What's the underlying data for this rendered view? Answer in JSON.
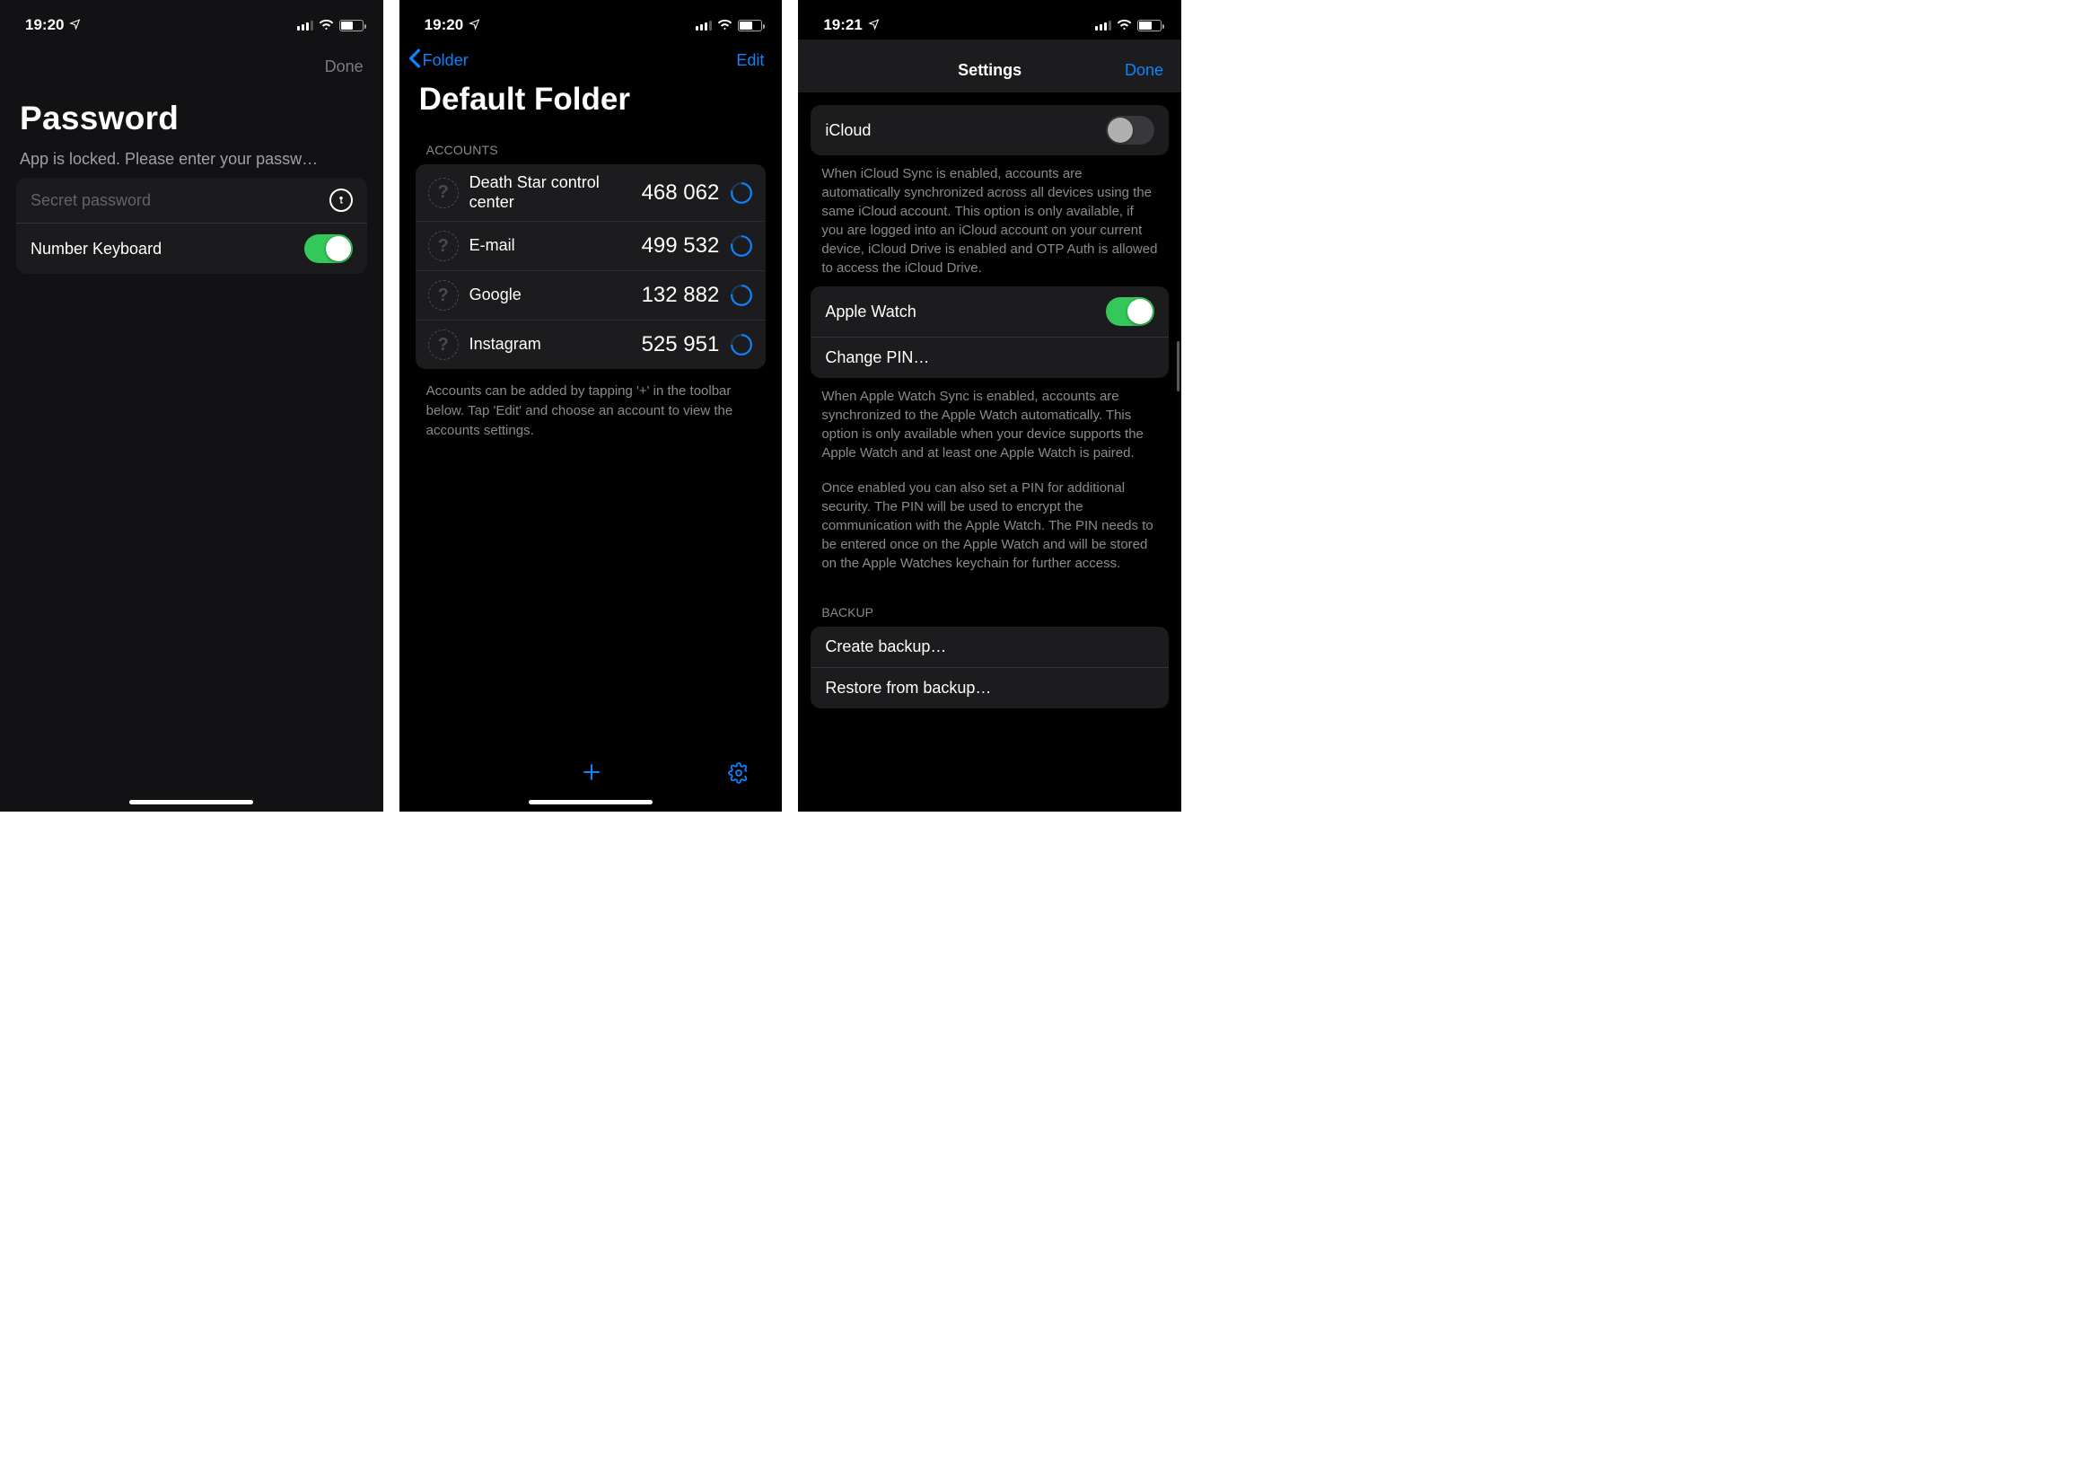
{
  "screen1": {
    "status_time": "19:20",
    "done_label": "Done",
    "title": "Password",
    "subtitle": "App is locked. Please enter your passw…",
    "password_placeholder": "Secret password",
    "number_keyboard_label": "Number Keyboard"
  },
  "screen2": {
    "status_time": "19:20",
    "back_label": "Folder",
    "edit_label": "Edit",
    "title": "Default Folder",
    "accounts_header": "ACCOUNTS",
    "accounts": [
      {
        "name": "Death Star control center",
        "code": "468 062"
      },
      {
        "name": "E-mail",
        "code": "499 532"
      },
      {
        "name": "Google",
        "code": "132 882"
      },
      {
        "name": "Instagram",
        "code": "525 951"
      }
    ],
    "footer": "Accounts can be added by tapping '+' in the toolbar below. Tap 'Edit' and choose an account to view the accounts settings."
  },
  "screen3": {
    "status_time": "19:21",
    "title": "Settings",
    "done_label": "Done",
    "icloud_label": "iCloud",
    "icloud_help": "When iCloud Sync is enabled, accounts are automatically synchronized across all devices using the same iCloud account. This option is only available, if you are logged into an iCloud account on your current device, iCloud Drive is enabled and OTP Auth is allowed to access the iCloud Drive.",
    "apple_watch_label": "Apple Watch",
    "change_pin_label": "Change PIN…",
    "watch_help1": "When Apple Watch Sync is enabled, accounts are synchronized to the Apple Watch automatically. This option is only available when your device supports the Apple Watch and at least one Apple Watch is paired.",
    "watch_help2": "Once enabled you can also set a PIN for additional security. The PIN will be used to encrypt the communication with the Apple Watch. The PIN needs to be entered once on the Apple Watch and will be stored on the Apple Watches keychain for further access.",
    "backup_header": "BACKUP",
    "create_backup_label": "Create backup…",
    "restore_backup_label": "Restore from backup…"
  }
}
